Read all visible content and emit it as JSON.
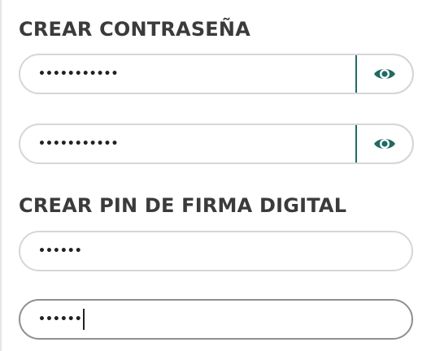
{
  "sections": {
    "password": {
      "title": "CREAR CONTRASEÑA",
      "field1": {
        "value": "•••••••••••",
        "toggle_icon": "eye-icon"
      },
      "field2": {
        "value": "•••••••••••",
        "toggle_icon": "eye-icon"
      }
    },
    "pin": {
      "title": "CREAR PIN DE FIRMA DIGITAL",
      "field1": {
        "value": "••••••"
      },
      "field2": {
        "value": "••••••"
      }
    }
  },
  "colors": {
    "accent": "#1f6b63",
    "heading": "#3b3b3b",
    "field_border": "#d6d6d6",
    "field_border_active": "#8f8f8f"
  }
}
